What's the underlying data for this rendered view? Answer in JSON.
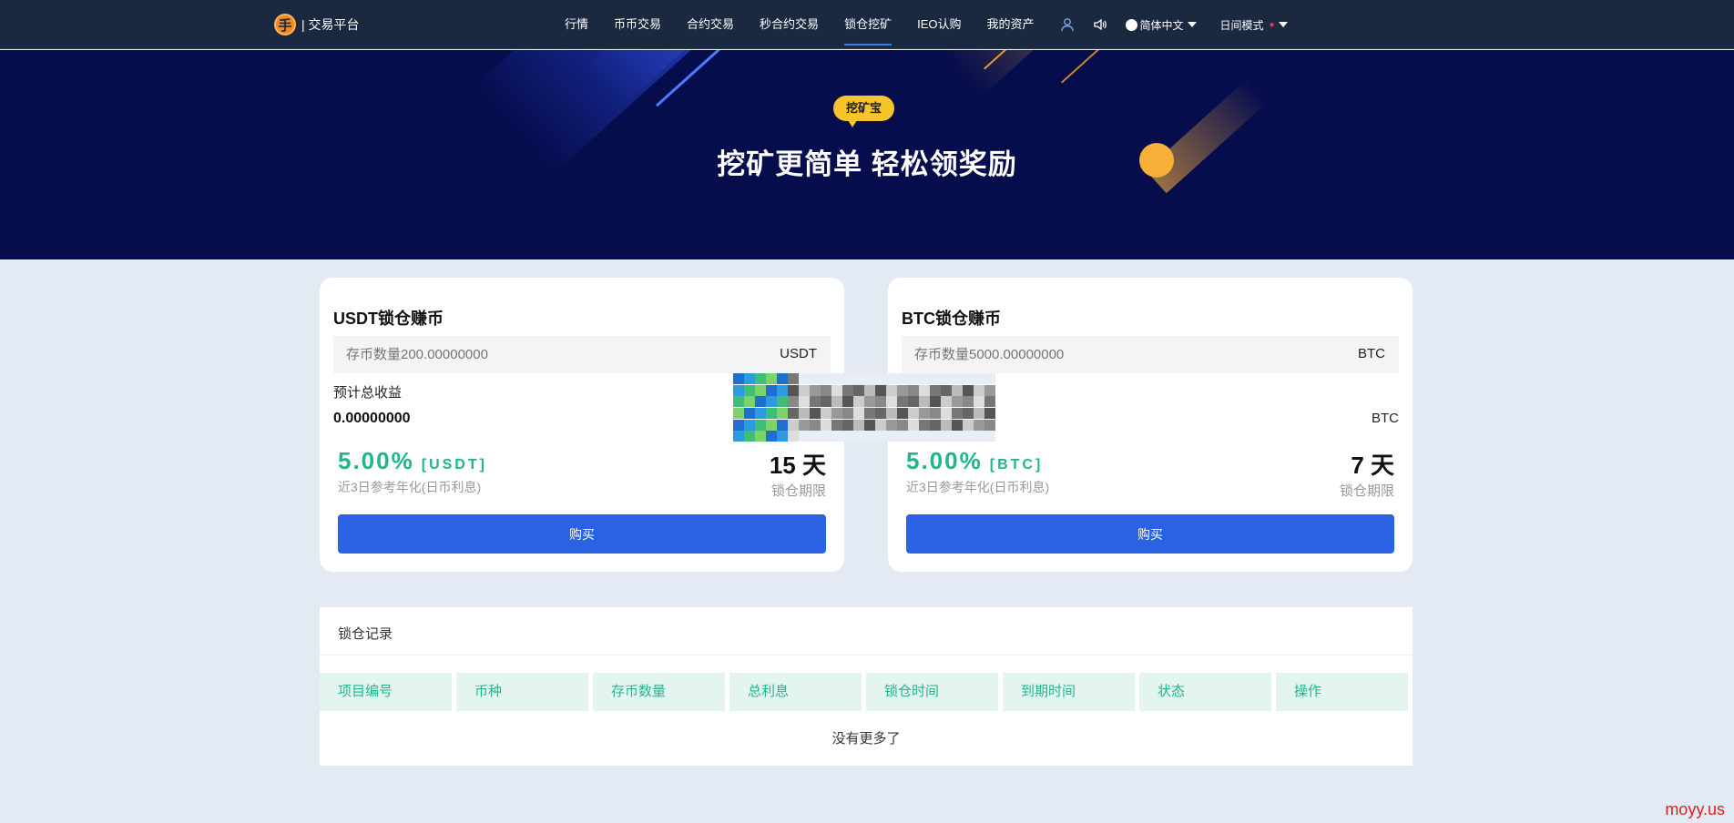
{
  "header": {
    "brand_logo_char": "手",
    "brand_text": "| 交易平台",
    "nav": [
      "行情",
      "币币交易",
      "合约交易",
      "秒合约交易",
      "锁仓挖矿",
      "IEO认购",
      "我的资产"
    ],
    "active_nav": "锁仓挖矿",
    "language": "简体中文",
    "mode": "日间模式",
    "mode_dot": "●"
  },
  "banner": {
    "badge": "挖矿宝",
    "title": "挖矿更简单 轻松领奖励"
  },
  "cards": [
    {
      "title": "USDT锁仓赚币",
      "amount_placeholder": "存币数量200.00000000",
      "unit": "USDT",
      "est_label": "预计总收益",
      "est_value": "0.00000000",
      "est_unit": "",
      "rate": "5.00%",
      "rate_unit": "[USDT]",
      "rate_label": "近3日参考年化(日币利息)",
      "days": "15 天",
      "days_label": "锁仓期限",
      "buy": "购买"
    },
    {
      "title": "BTC锁仓赚币",
      "amount_placeholder": "存币数量5000.00000000",
      "unit": "BTC",
      "est_label": "",
      "est_value": "",
      "est_unit": "BTC",
      "rate": "5.00%",
      "rate_unit": "[BTC]",
      "rate_label": "近3日参考年化(日币利息)",
      "days": "7 天",
      "days_label": "锁仓期限",
      "buy": "购买"
    }
  ],
  "records": {
    "title": "锁仓记录",
    "columns": [
      "项目编号",
      "币种",
      "存币数量",
      "总利息",
      "锁仓时间",
      "到期时间",
      "状态",
      "操作"
    ],
    "empty_text": "没有更多了"
  },
  "watermark": "moyy.us",
  "colors": {
    "header_bg": "#1b2940",
    "banner_bg": "#060d4d",
    "accent_green": "#20b58d",
    "button_blue": "#2b62e3",
    "badge_yellow": "#f7c52b"
  }
}
